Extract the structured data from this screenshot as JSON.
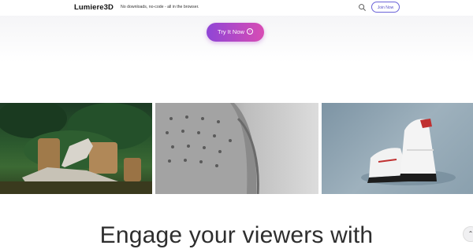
{
  "header": {
    "logo": "Lumiere3D",
    "tagline": "No downloads, no-code - all in the browser.",
    "search_icon": "search-icon",
    "join_label": "Join Now"
  },
  "hero": {
    "cta_label": "Try It Now",
    "cta_icon": "arrow-circle-right-icon",
    "cta_color_start": "#8f45d6",
    "cta_color_end": "#d84cb4"
  },
  "gallery": [
    {
      "alt": "sneaker on wooden stumps with greenery",
      "icon": "image"
    },
    {
      "alt": "close-up of grey perforated sneaker toe",
      "icon": "image"
    },
    {
      "alt": "white and red high-top sneakers",
      "icon": "image"
    }
  ],
  "section": {
    "heading": "Engage your viewers with"
  },
  "scroll_top_icon": "chevron-up-icon"
}
